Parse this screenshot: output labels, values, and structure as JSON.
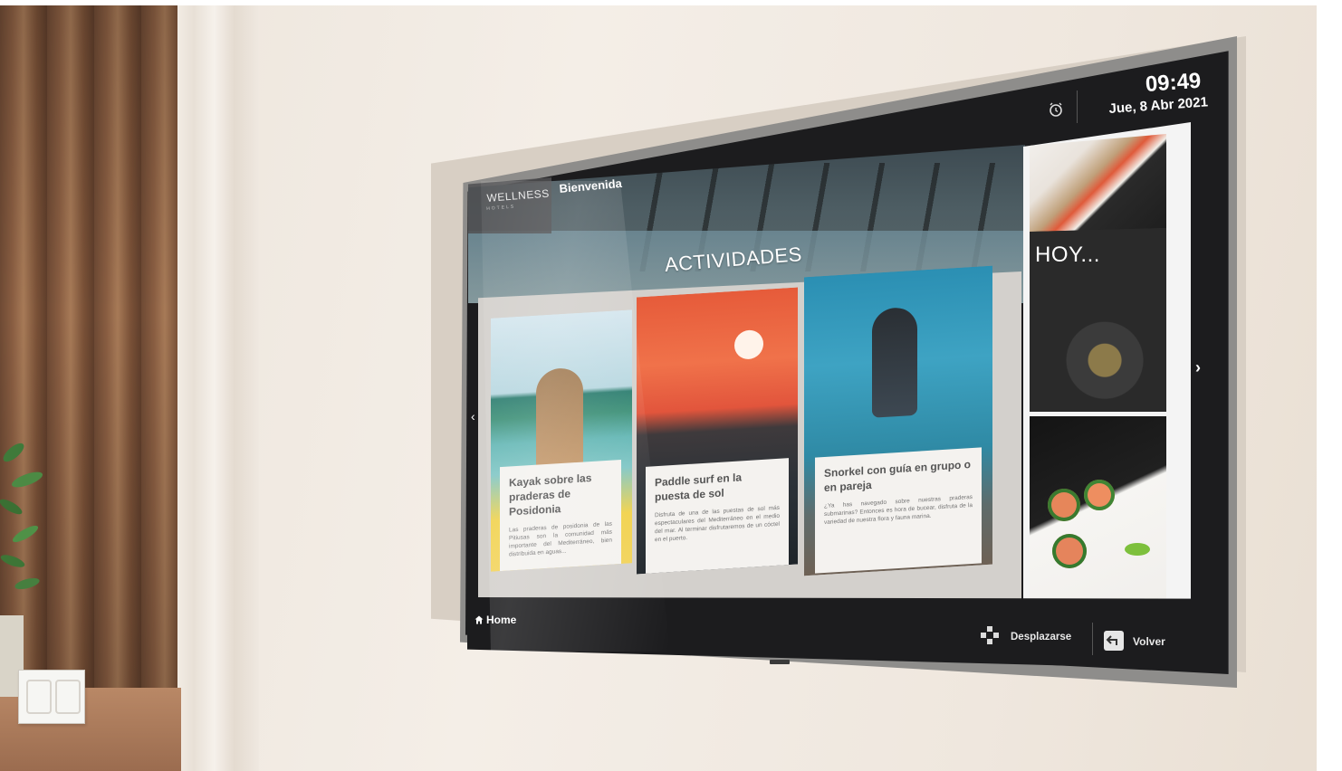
{
  "header": {
    "logo_text": "WELLNESS",
    "logo_sub": "HOTELS",
    "tab_welcome": "Bienvenida"
  },
  "clock": {
    "time": "09:49",
    "date": "Jue, 8 Abr 2021"
  },
  "section_title": "ACTIVIDADES",
  "cards": [
    {
      "title": "Kayak sobre las praderas de Posidonia",
      "desc": "Las praderas de posidonia de las Pitiusas son la comunidad más importante del Mediterráneo, bien distribuida en aguas..."
    },
    {
      "title": "Paddle surf en la puesta de sol",
      "desc": "Disfruta de una de las puestas de sol más espectaculares del Mediterráneo en el medio del mar. Al terminar disfrutaremos de un cóctel en el puerto."
    },
    {
      "title": "Snorkel con guía en grupo o en pareja",
      "desc": "¿Ya has navegado sobre nuestras praderas submarinas? Entonces es hora de bucear, disfruta de la variedad de nuestra flora y fauna marina."
    }
  ],
  "right_panel": {
    "today_label": "HOY..."
  },
  "footer": {
    "home_label": "Home",
    "scroll_label": "Desplazarse",
    "back_label": "Volver"
  },
  "icons": {
    "alarm": "alarm-clock-icon",
    "home": "home-icon",
    "dpad": "dpad-icon",
    "back": "back-arrow-icon",
    "next": "chevron-right-icon",
    "prev": "chevron-left-icon"
  },
  "colors": {
    "screen_dark": "#1c1c1e",
    "content_bg": "#d3d0cc",
    "card_bg": "#f4f2ef",
    "text_white": "#ffffff"
  }
}
